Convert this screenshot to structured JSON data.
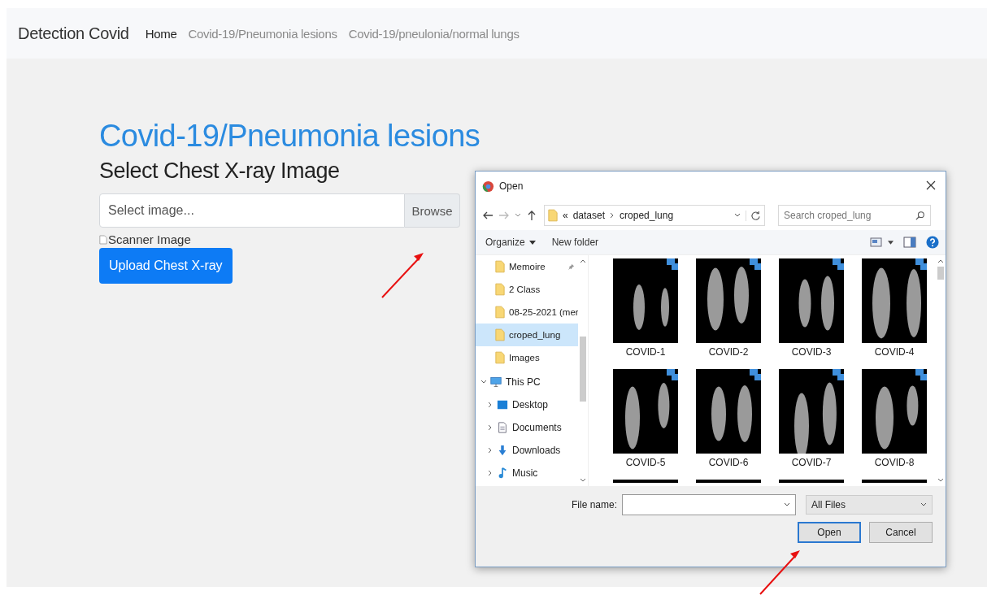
{
  "navbar": {
    "brand": "Detection Covid",
    "links": [
      {
        "label": "Home",
        "selected": true
      },
      {
        "label": "Covid-19/Pneumonia lesions",
        "selected": false
      },
      {
        "label": "Covid-19/pneulonia/normal lungs",
        "selected": false
      }
    ]
  },
  "page": {
    "title": "Covid-19/Pneumonia lesions",
    "subtitle": "Select Chest X-ray Image",
    "file_input": {
      "placeholder": "Select image...",
      "button": "Browse"
    },
    "image_alt": "Scanner Image",
    "upload_button": "Upload Chest X-ray"
  },
  "dialog": {
    "title": "Open",
    "address": {
      "overflow": "«",
      "path": [
        "dataset",
        "croped_lung"
      ]
    },
    "search": {
      "placeholder": "Search croped_lung"
    },
    "toolbar": {
      "organize": "Organize",
      "new_folder": "New folder"
    },
    "nav_tree": [
      {
        "label": "Memoire",
        "kind": "folder",
        "selected": false,
        "pinned": true
      },
      {
        "label": "2 Class",
        "kind": "folder",
        "selected": false,
        "pinned": false
      },
      {
        "label": "08-25-2021 (mer",
        "kind": "folder",
        "selected": false,
        "pinned": false
      },
      {
        "label": "croped_lung",
        "kind": "folder",
        "selected": true,
        "pinned": false
      },
      {
        "label": "Images",
        "kind": "folder",
        "selected": false,
        "pinned": false
      },
      {
        "label": "This PC",
        "kind": "pc",
        "selected": false,
        "expanded": true,
        "children": [
          {
            "label": "Desktop",
            "kind": "desktop",
            "selected": false,
            "expanded": false
          },
          {
            "label": "Documents",
            "kind": "documents",
            "selected": false,
            "expanded": false
          },
          {
            "label": "Downloads",
            "kind": "downloads",
            "selected": false,
            "expanded": false
          },
          {
            "label": "Music",
            "kind": "music",
            "selected": false,
            "expanded": false
          }
        ]
      }
    ],
    "files": [
      {
        "name": "COVID-1"
      },
      {
        "name": "COVID-2"
      },
      {
        "name": "COVID-3"
      },
      {
        "name": "COVID-4"
      },
      {
        "name": "COVID-5"
      },
      {
        "name": "COVID-6"
      },
      {
        "name": "COVID-7"
      },
      {
        "name": "COVID-8"
      }
    ],
    "file_name_label": "File name:",
    "file_type": "All Files",
    "buttons": [
      {
        "label": "Open",
        "default": true
      },
      {
        "label": "Cancel",
        "default": false
      }
    ]
  }
}
